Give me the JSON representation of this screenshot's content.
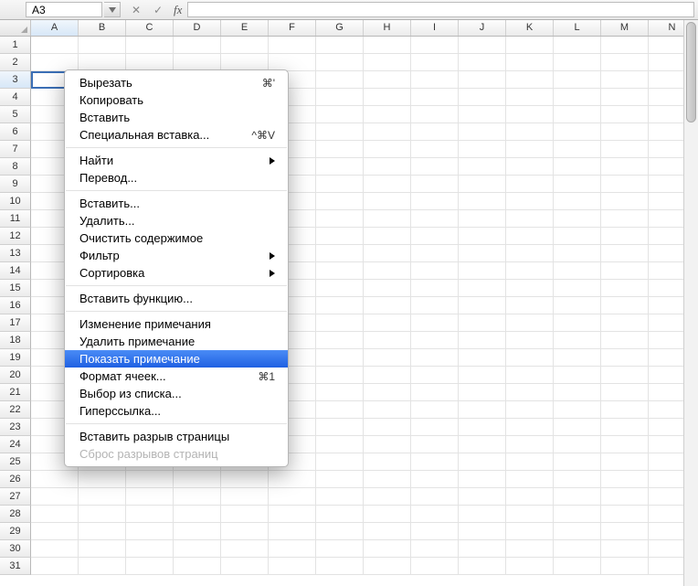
{
  "formula_bar": {
    "cell_ref": "A3",
    "fx_label": "fx",
    "cancel_glyph": "✕",
    "confirm_glyph": "✓"
  },
  "columns": [
    "A",
    "B",
    "C",
    "D",
    "E",
    "F",
    "G",
    "H",
    "I",
    "J",
    "K",
    "L",
    "M",
    "N"
  ],
  "rows": [
    "1",
    "2",
    "3",
    "4",
    "5",
    "6",
    "7",
    "8",
    "9",
    "10",
    "11",
    "12",
    "13",
    "14",
    "15",
    "16",
    "17",
    "18",
    "19",
    "20",
    "21",
    "22",
    "23",
    "24",
    "25",
    "26",
    "27",
    "28",
    "29",
    "30",
    "31"
  ],
  "active": {
    "col_index": 0,
    "row_index": 2
  },
  "context_menu": {
    "items": [
      {
        "label": "Вырезать",
        "shortcut": "⌘'",
        "type": "item"
      },
      {
        "label": "Копировать",
        "type": "item"
      },
      {
        "label": "Вставить",
        "type": "item"
      },
      {
        "label": "Специальная вставка...",
        "shortcut": "^⌘V",
        "type": "item"
      },
      {
        "type": "sep"
      },
      {
        "label": "Найти",
        "type": "submenu"
      },
      {
        "label": "Перевод...",
        "type": "item"
      },
      {
        "type": "sep"
      },
      {
        "label": "Вставить...",
        "type": "item"
      },
      {
        "label": "Удалить...",
        "type": "item"
      },
      {
        "label": "Очистить содержимое",
        "type": "item"
      },
      {
        "label": "Фильтр",
        "type": "submenu"
      },
      {
        "label": "Сортировка",
        "type": "submenu"
      },
      {
        "type": "sep"
      },
      {
        "label": "Вставить функцию...",
        "type": "item"
      },
      {
        "type": "sep"
      },
      {
        "label": "Изменение примечания",
        "type": "item"
      },
      {
        "label": "Удалить примечание",
        "type": "item"
      },
      {
        "label": "Показать примечание",
        "type": "item",
        "highlight": true
      },
      {
        "label": "Формат ячеек...",
        "shortcut": "⌘1",
        "type": "item"
      },
      {
        "label": "Выбор из списка...",
        "type": "item"
      },
      {
        "label": "Гиперссылка...",
        "type": "item"
      },
      {
        "type": "sep"
      },
      {
        "label": "Вставить разрыв страницы",
        "type": "item"
      },
      {
        "label": "Сброс разрывов страниц",
        "type": "item",
        "disabled": true
      }
    ]
  }
}
